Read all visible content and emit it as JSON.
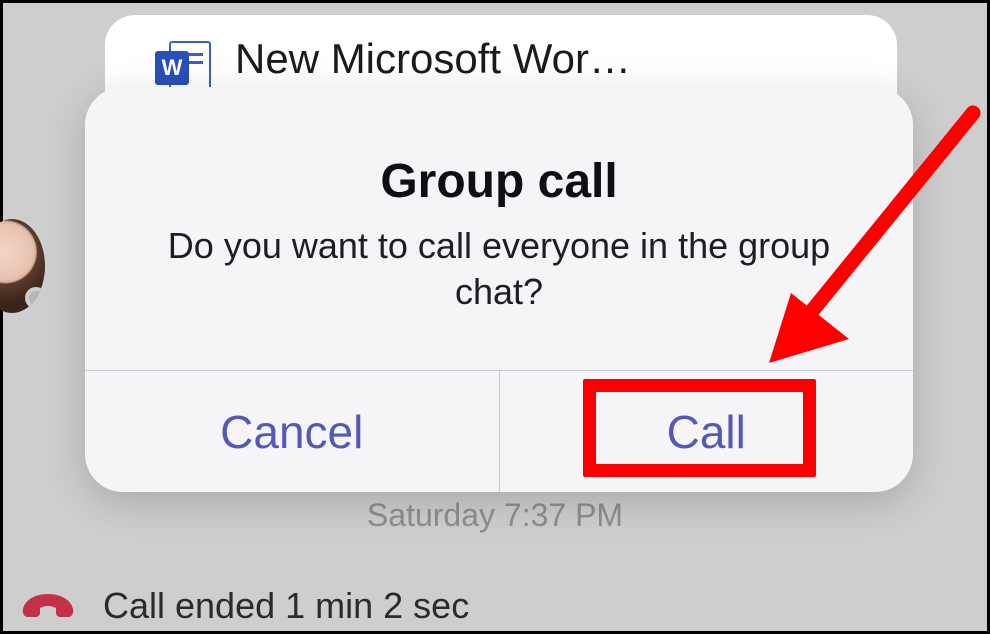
{
  "background": {
    "file_card": {
      "file_name": "New Microsoft Wor…",
      "icon_letter": "W",
      "icon_name": "word-document-icon"
    },
    "timestamp": "Saturday 7:37 PM",
    "call_status": "Call ended 1 min 2 sec",
    "avatar": {
      "presence": "offline"
    }
  },
  "dialog": {
    "title": "Group call",
    "message": "Do you want to call everyone in the group chat?",
    "cancel_label": "Cancel",
    "call_label": "Call"
  },
  "annotation": {
    "arrow_target": "call-button",
    "highlight_target": "call-button",
    "highlight_color": "#ff0000"
  }
}
